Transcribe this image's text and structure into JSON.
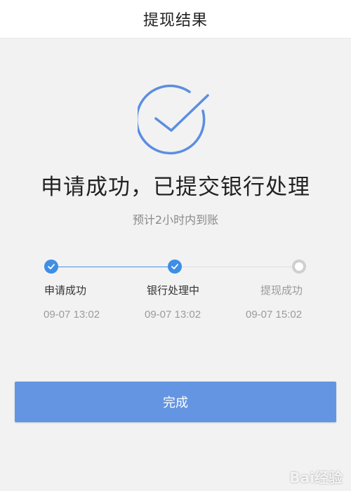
{
  "header": {
    "title": "提现结果"
  },
  "result": {
    "title": "申请成功，已提交银行处理",
    "subtitle": "预计2小时内到账"
  },
  "steps": [
    {
      "label": "申请成功",
      "time": "09-07 13:02",
      "status": "done"
    },
    {
      "label": "银行处理中",
      "time": "09-07 13:02",
      "status": "done"
    },
    {
      "label": "提现成功",
      "time": "09-07 15:02",
      "status": "pending"
    }
  ],
  "actions": {
    "done_label": "完成"
  },
  "watermark": {
    "text": "Bai经验"
  },
  "colors": {
    "accent": "#3e8ee6",
    "button": "#6495e2",
    "icon": "#5b8ee0",
    "pending": "#cfcfcf",
    "background": "#f2f2f2"
  },
  "icons": {
    "result": "check-circle-icon",
    "step_done": "check-icon",
    "step_pending": "ring-icon"
  }
}
